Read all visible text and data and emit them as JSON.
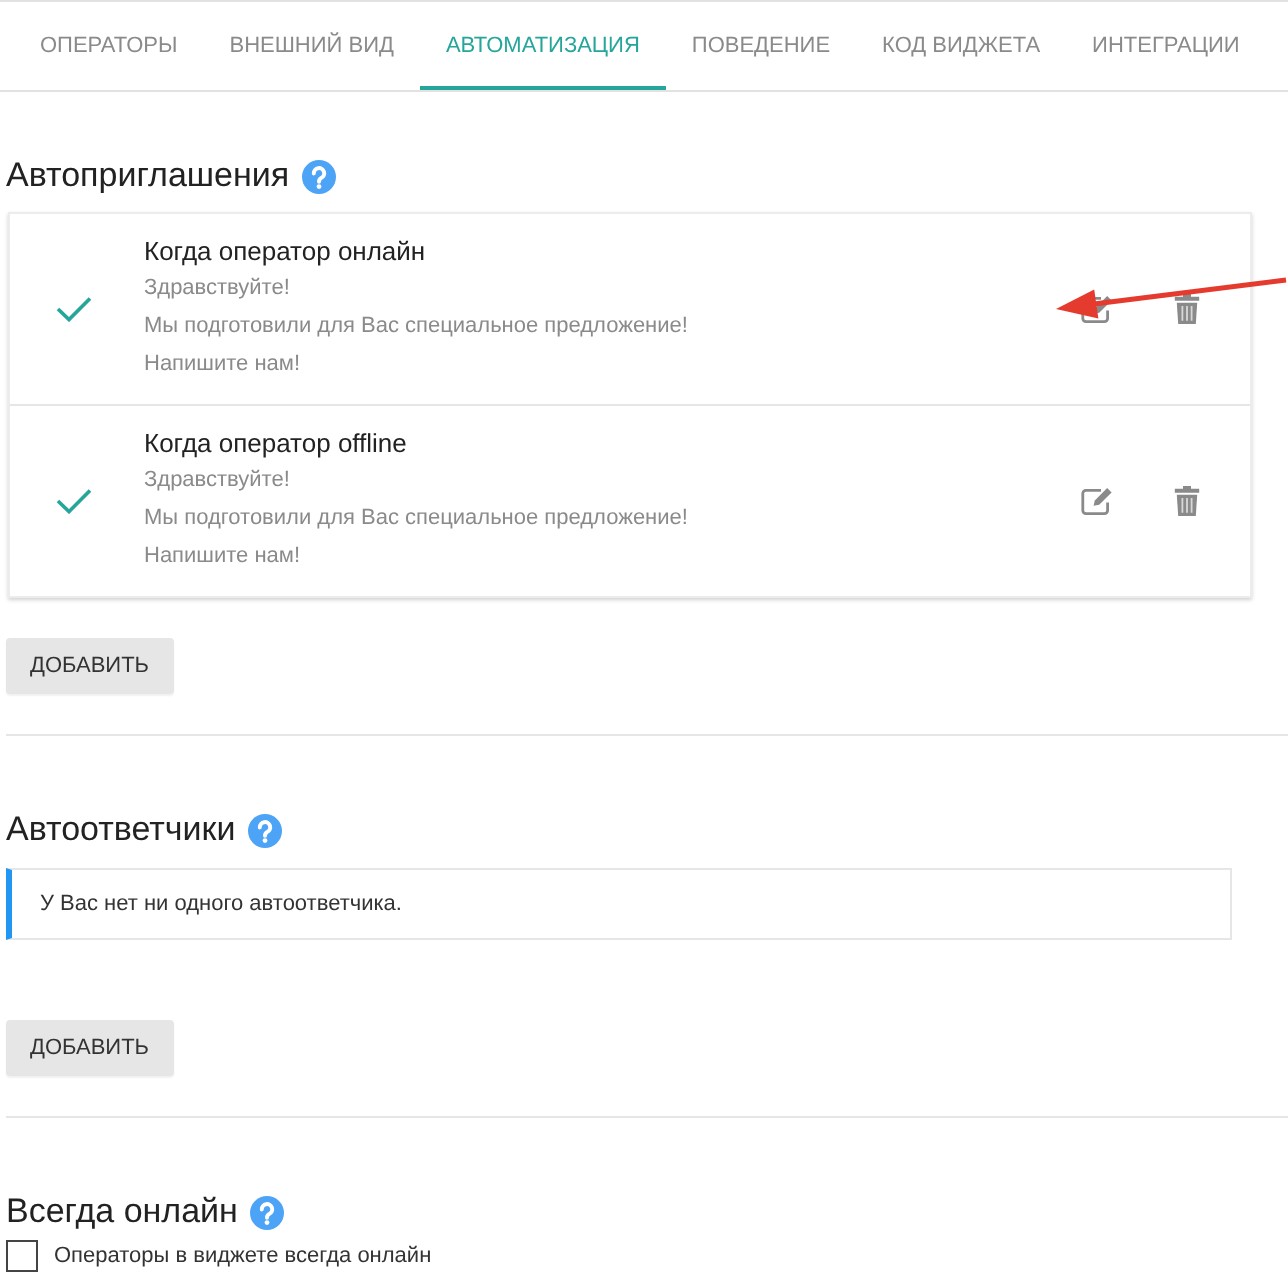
{
  "tabs": [
    {
      "label": "ОПЕРАТОРЫ",
      "selected": false
    },
    {
      "label": "ВНЕШНИЙ ВИД",
      "selected": false
    },
    {
      "label": "АВТОМАТИЗАЦИЯ",
      "selected": true
    },
    {
      "label": "ПОВЕДЕНИЕ",
      "selected": false
    },
    {
      "label": "КОД ВИДЖЕТА",
      "selected": false
    },
    {
      "label": "ИНТЕГРАЦИИ",
      "selected": false
    }
  ],
  "sections": [
    {
      "kind": "list",
      "title": "Автоприглашения",
      "items": [
        {
          "title": "Когда оператор онлайн",
          "active": true,
          "annotated": true,
          "lines": [
            "Здравствуйте!",
            "Мы подготовили для Вас специальное предложение!",
            "Напишите нам!"
          ]
        },
        {
          "title": "Когда оператор offline",
          "active": true,
          "annotated": false,
          "lines": [
            "Здравствуйте!",
            "Мы подготовили для Вас специальное предложение!",
            "Напишите нам!"
          ]
        }
      ],
      "add_button": "ДОБАВИТЬ"
    },
    {
      "kind": "notice",
      "title": "Автоответчики",
      "notice": "У Вас нет ни одного автоответчика.",
      "add_button": "ДОБАВИТЬ"
    },
    {
      "kind": "checkbox",
      "title": "Всегда онлайн",
      "checkbox": {
        "label": "Операторы в виджете всегда онлайн",
        "checked": false
      }
    }
  ]
}
